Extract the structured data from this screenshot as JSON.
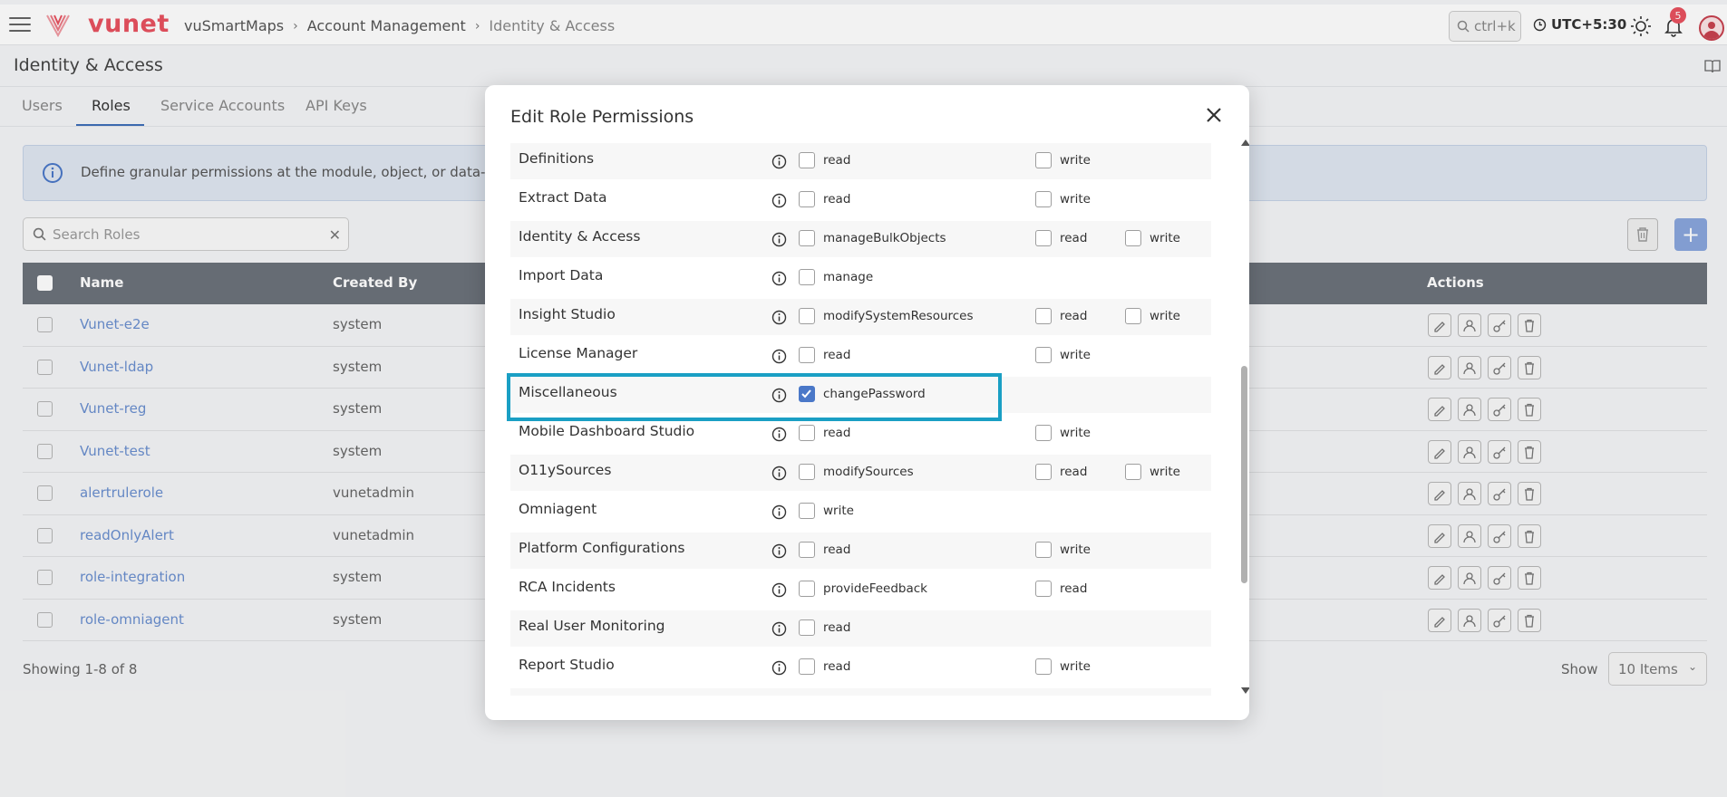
{
  "topbar": {
    "logo_text": "vunet",
    "breadcrumbs": [
      "vuSmartMaps",
      "Account Management",
      "Identity & Access"
    ],
    "search_hint": "ctrl+k",
    "timezone": "UTC+5:30",
    "notification_count": "5",
    "brand_color": "#e8525f"
  },
  "page": {
    "title": "Identity & Access",
    "tabs": [
      "Users",
      "Roles",
      "Service Accounts",
      "API Keys"
    ],
    "active_tab": "Roles"
  },
  "banner": {
    "text": "Define granular permissions at the module, object, or data-acc"
  },
  "roles_search": {
    "placeholder": "Search Roles"
  },
  "table": {
    "columns": [
      "Name",
      "Created By",
      "Actions"
    ],
    "rows": [
      {
        "name": "Vunet-e2e",
        "created_by": "system"
      },
      {
        "name": "Vunet-ldap",
        "created_by": "system"
      },
      {
        "name": "Vunet-reg",
        "created_by": "system"
      },
      {
        "name": "Vunet-test",
        "created_by": "system"
      },
      {
        "name": "alertrulerole",
        "created_by": "vunetadmin"
      },
      {
        "name": "readOnlyAlert",
        "created_by": "vunetadmin"
      },
      {
        "name": "role-integration",
        "created_by": "system"
      },
      {
        "name": "role-omniagent",
        "created_by": "system"
      }
    ],
    "action_icons": [
      "edit-icon",
      "user-assign-icon",
      "key-icon",
      "trash-icon"
    ]
  },
  "pagination": {
    "showing": "Showing 1-8 of 8",
    "show_label": "Show",
    "page_size": "10 Items"
  },
  "modal": {
    "title": "Edit Role Permissions",
    "rows": [
      {
        "label": "Definitions",
        "opts": [
          {
            "text": "read",
            "checked": false
          },
          {
            "text": "write",
            "checked": false
          }
        ]
      },
      {
        "label": "Extract Data",
        "opts": [
          {
            "text": "read",
            "checked": false
          },
          {
            "text": "write",
            "checked": false
          }
        ]
      },
      {
        "label": "Identity & Access",
        "opts": [
          {
            "text": "manageBulkObjects",
            "checked": false
          },
          {
            "text": "read",
            "checked": false
          },
          {
            "text": "write",
            "checked": false
          }
        ]
      },
      {
        "label": "Import Data",
        "opts": [
          {
            "text": "manage",
            "checked": false
          }
        ]
      },
      {
        "label": "Insight Studio",
        "opts": [
          {
            "text": "modifySystemResources",
            "checked": false
          },
          {
            "text": "read",
            "checked": false
          },
          {
            "text": "write",
            "checked": false
          }
        ]
      },
      {
        "label": "License Manager",
        "opts": [
          {
            "text": "read",
            "checked": false
          },
          {
            "text": "write",
            "checked": false
          }
        ]
      },
      {
        "label": "Miscellaneous",
        "opts": [
          {
            "text": "changePassword",
            "checked": true
          }
        ]
      },
      {
        "label": "Mobile Dashboard Studio",
        "opts": [
          {
            "text": "read",
            "checked": false
          },
          {
            "text": "write",
            "checked": false
          }
        ]
      },
      {
        "label": "O11ySources",
        "opts": [
          {
            "text": "modifySources",
            "checked": false
          },
          {
            "text": "read",
            "checked": false
          },
          {
            "text": "write",
            "checked": false
          }
        ]
      },
      {
        "label": "Omniagent",
        "opts": [
          {
            "text": "write",
            "checked": false
          }
        ]
      },
      {
        "label": "Platform Configurations",
        "opts": [
          {
            "text": "read",
            "checked": false
          },
          {
            "text": "write",
            "checked": false
          }
        ]
      },
      {
        "label": "RCA Incidents",
        "opts": [
          {
            "text": "provideFeedback",
            "checked": false
          },
          {
            "text": "read",
            "checked": false
          }
        ]
      },
      {
        "label": "Real User Monitoring",
        "opts": [
          {
            "text": "read",
            "checked": false
          }
        ]
      },
      {
        "label": "Report Studio",
        "opts": [
          {
            "text": "read",
            "checked": false
          },
          {
            "text": "write",
            "checked": false
          }
        ]
      }
    ],
    "highlight_color": "#1a9fc4"
  }
}
